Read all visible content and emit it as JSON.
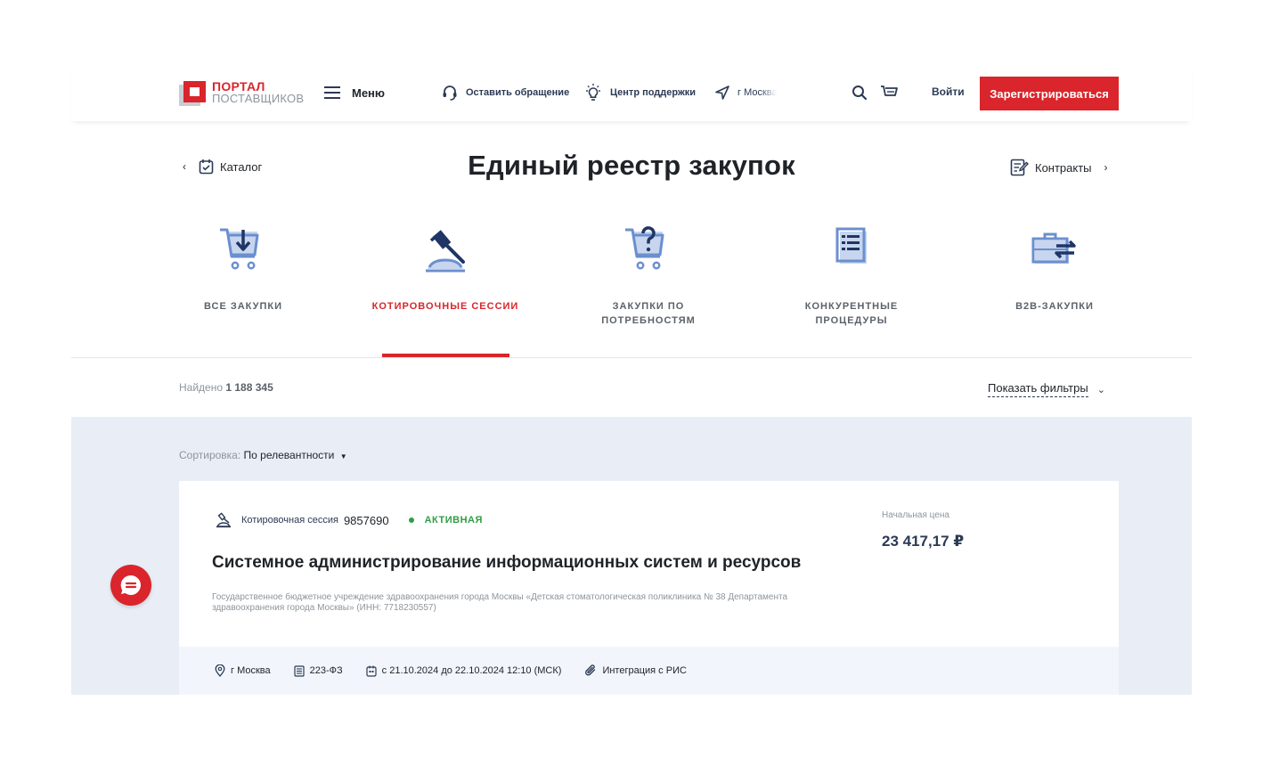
{
  "header": {
    "logo_line1": "ПОРТАЛ",
    "logo_line2": "ПОСТАВЩИКОВ",
    "menu_label": "Меню",
    "feedback_label": "Оставить обращение",
    "support_label": "Центр поддержки",
    "city_label": "г Москва",
    "login_label": "Войти",
    "register_label": "Зарегистрироваться",
    "icons": [
      "headset-icon",
      "lightbulb-icon",
      "location-arrow-icon",
      "search-icon",
      "cart-icon"
    ]
  },
  "nav": {
    "back_label": "Каталог",
    "title": "Единый реестр закупок",
    "forward_label": "Контракты"
  },
  "categories": [
    {
      "label": "ВСЕ ЗАКУПКИ",
      "icon": "cart-download-icon",
      "active": false
    },
    {
      "label": "КОТИРОВОЧНЫЕ СЕССИИ",
      "icon": "gavel-icon",
      "active": true
    },
    {
      "label": "ЗАКУПКИ ПО ПОТРЕБНОСТЯМ",
      "icon": "cart-question-icon",
      "active": false
    },
    {
      "label": "КОНКУРЕНТНЫЕ ПРОЦЕДУРЫ",
      "icon": "document-list-icon",
      "active": false
    },
    {
      "label": "B2B-ЗАКУПКИ",
      "icon": "briefcase-exchange-icon",
      "active": false
    }
  ],
  "results": {
    "found_label": "Найдено",
    "found_count": "1 188 345",
    "filters_label": "Показать фильтры",
    "sort_label": "Сортировка:",
    "sort_value": "По релевантности"
  },
  "card": {
    "type_label": "Котировочная сессия",
    "number": "9857690",
    "status": "АКТИВНАЯ",
    "title": "Системное администрирование информационных систем и ресурсов",
    "organization": "Государственное бюджетное учреждение здравоохранения города Москвы «Детская стоматологическая поликлиника № 38 Департамента здравоохранения города Москвы» (ИНН: 7718230557)",
    "price_label": "Начальная цена",
    "price_value": "23 417,17 ₽",
    "location": "г Москва",
    "law": "223-ФЗ",
    "dates": "с 21.10.2024 до 22.10.2024 12:10 (МСК)",
    "integration": "Интеграция с РИС"
  },
  "colors": {
    "brand_red": "#d9252b",
    "navy": "#2b3a55",
    "icon_blue": "#6b8fcf",
    "status_green": "#2f9e44",
    "list_bg": "#e9eef6"
  }
}
